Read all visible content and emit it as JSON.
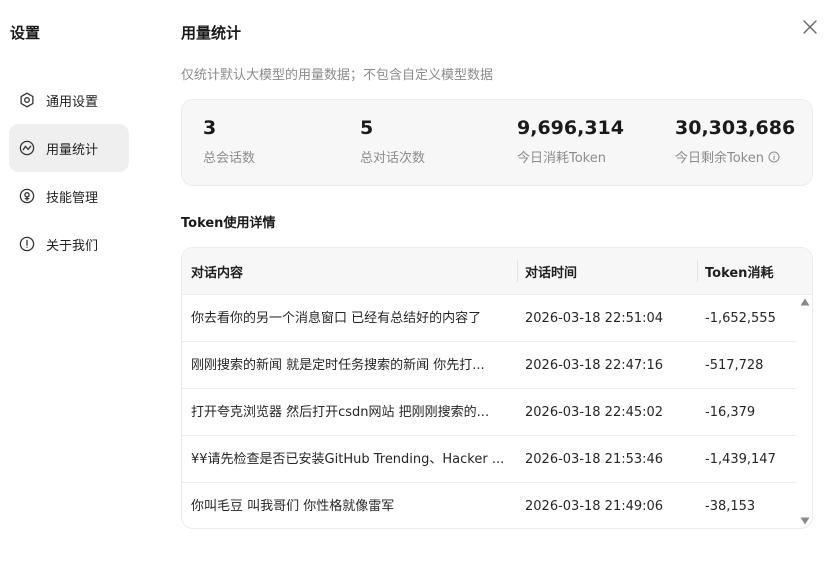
{
  "sidebar": {
    "title": "设置",
    "items": [
      {
        "label": "通用设置",
        "icon": "gear-icon",
        "active": false
      },
      {
        "label": "用量统计",
        "icon": "chart-line-icon",
        "active": true
      },
      {
        "label": "技能管理",
        "icon": "skill-icon",
        "active": false
      },
      {
        "label": "关于我们",
        "icon": "info-icon",
        "active": false
      }
    ]
  },
  "main": {
    "title": "用量统计",
    "subtitle": "仅统计默认大模型的用量数据；不包含自定义模型数据",
    "stats": [
      {
        "value": "3",
        "label": "总会话数"
      },
      {
        "value": "5",
        "label": "总对话次数"
      },
      {
        "value": "9,696,314",
        "label": "今日消耗Token"
      },
      {
        "value": "30,303,686",
        "label": "今日剩余Token"
      }
    ],
    "details_title": "Token使用详情",
    "table": {
      "columns": [
        "对话内容",
        "对话时间",
        "Token消耗"
      ],
      "rows": [
        [
          "你去看你的另一个消息窗口 已经有总结好的内容了",
          "2026-03-18 22:51:04",
          "-1,652,555"
        ],
        [
          "刚刚搜索的新闻 就是定时任务搜索的新闻 你先打...",
          "2026-03-18 22:47:16",
          "-517,728"
        ],
        [
          "打开夸克浏览器 然后打开csdn网站 把刚刚搜索的...",
          "2026-03-18 22:45:02",
          "-16,379"
        ],
        [
          "¥¥请先检查是否已安装GitHub Trending、Hacker ...",
          "2026-03-18 21:53:46",
          "-1,439,147"
        ],
        [
          "你叫毛豆 叫我哥们 你性格就像雷军",
          "2026-03-18 21:49:06",
          "-38,153"
        ]
      ]
    }
  },
  "colors": {
    "accent_bg": "#efefef",
    "muted_text": "#8c8c8c",
    "card_bg": "#f7f7f7",
    "border": "#ececec"
  }
}
